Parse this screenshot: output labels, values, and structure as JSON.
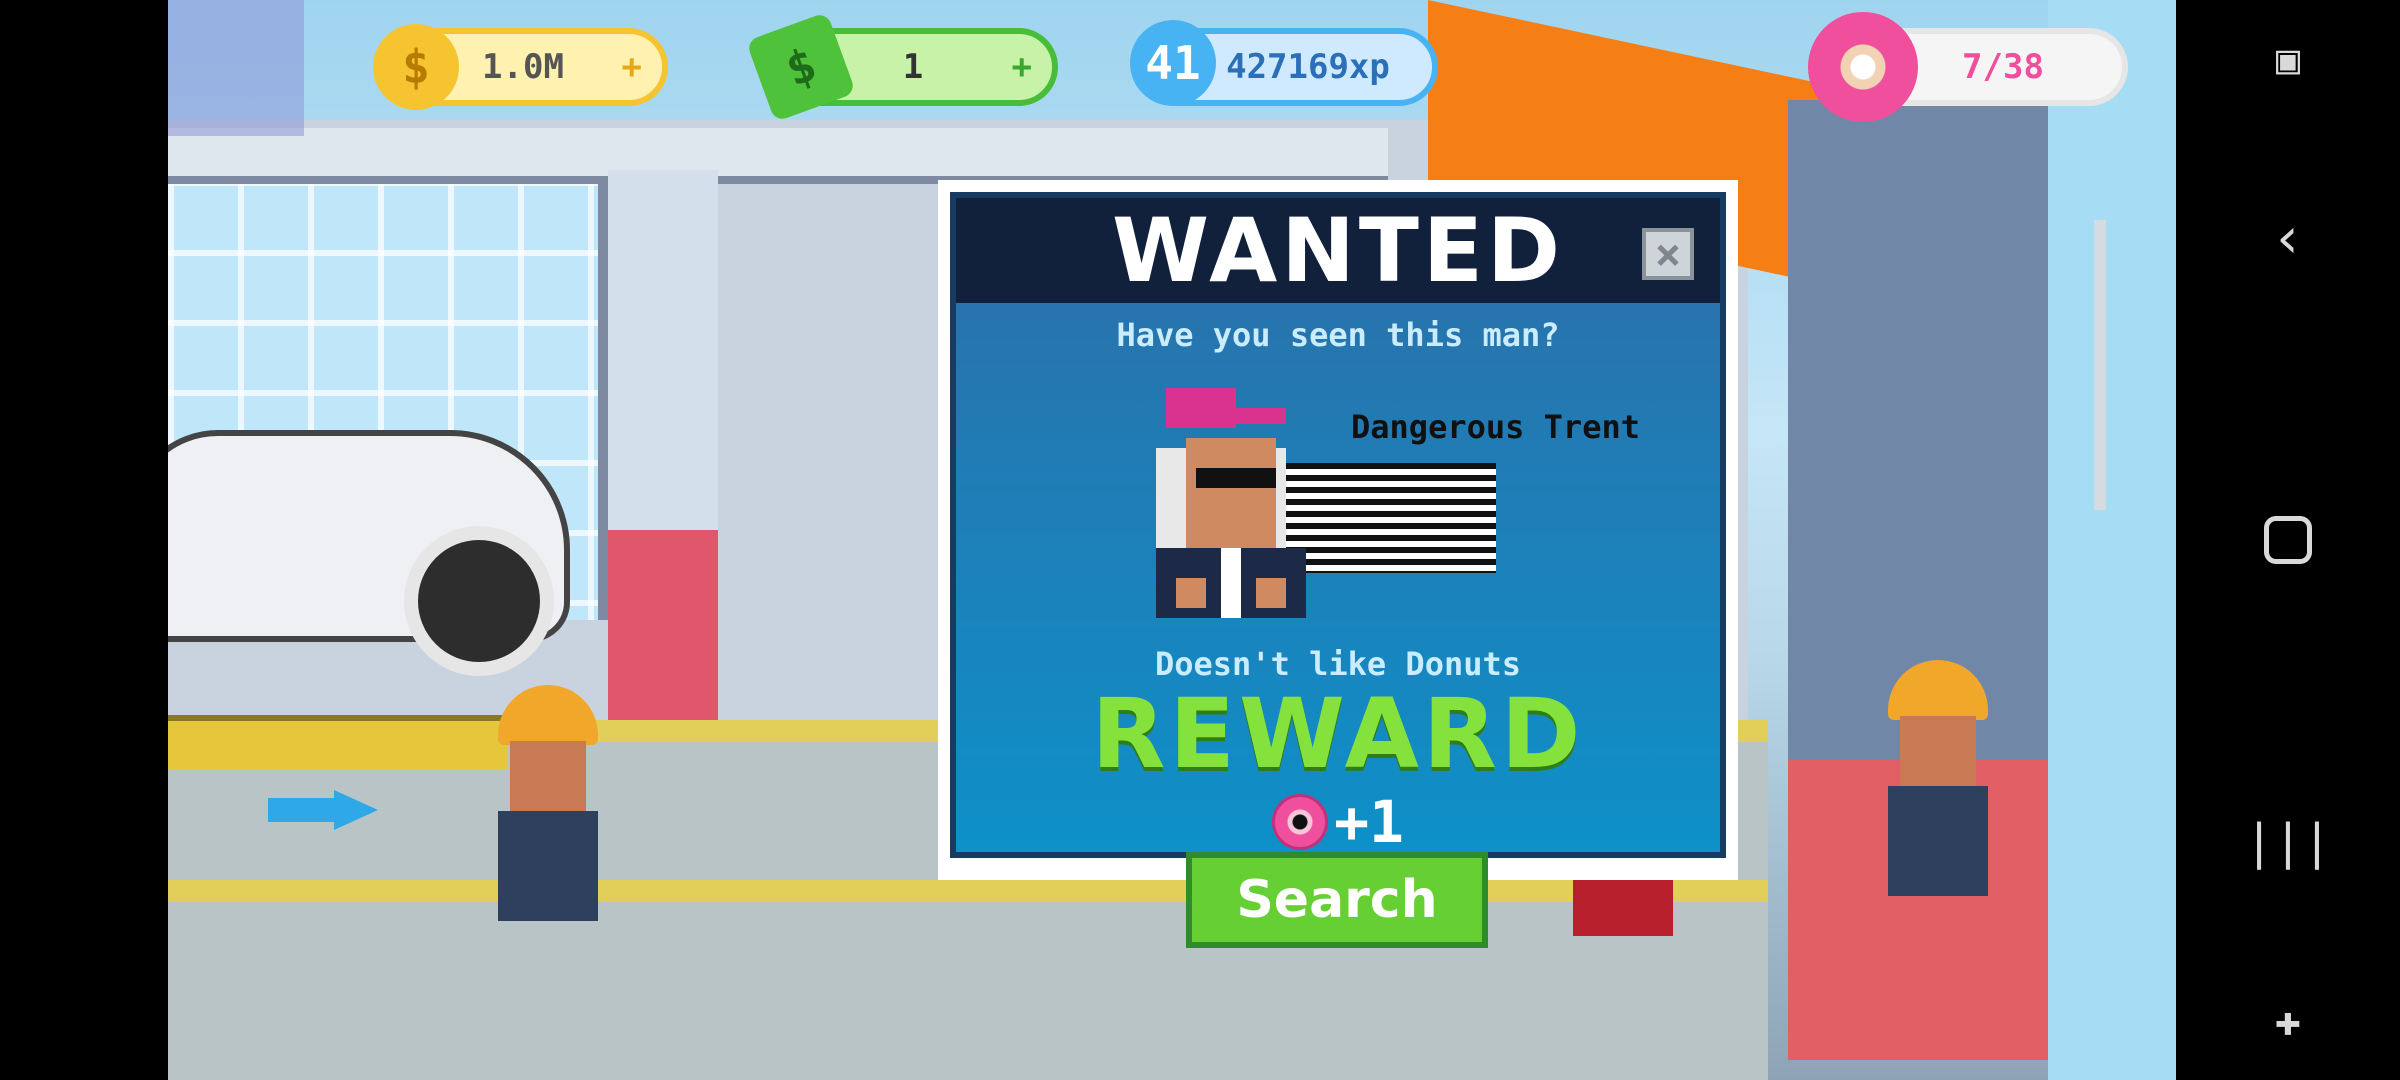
{
  "hud": {
    "coins": "1.0M",
    "cash": "1",
    "level": "41",
    "xp": "427169xp",
    "donuts": "7/38",
    "plus_symbol": "+"
  },
  "dialog": {
    "title": "WANTED",
    "question": "Have you seen this man?",
    "suspect_name": "Dangerous Trent",
    "description": "Doesn't like Donuts",
    "reward_label": "REWARD",
    "reward_amount": "+1",
    "search_label": "Search"
  },
  "colors": {
    "coin": "#f6c430",
    "cash": "#47bd3a",
    "xp": "#48b3f3",
    "donut": "#ef4f9c",
    "reward": "#85e23c",
    "search": "#66cf34"
  }
}
